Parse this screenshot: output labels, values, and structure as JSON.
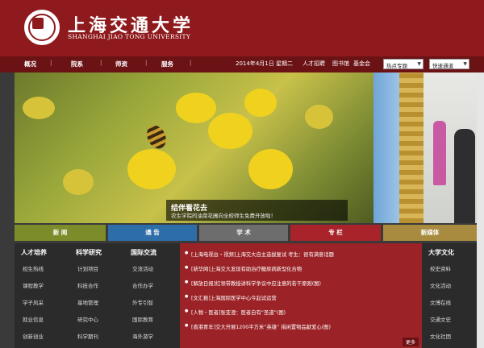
{
  "header": {
    "title_cn": "上海交通大学",
    "title_en": "SHANGHAI JIAO TONG UNIVERSITY"
  },
  "nav": {
    "items": [
      "概况",
      "院系",
      "师资",
      "服务"
    ],
    "separator": "|",
    "date": "2014年4月1日  星期二",
    "links": [
      "人才招聘",
      "图书馆",
      "基金会"
    ],
    "selects": [
      "热点专题",
      "快速通道"
    ]
  },
  "banner": {
    "caption_title": "结伴看花去",
    "caption_sub": "农生学院的油菜花圃向全校师生免费开放啦！"
  },
  "tabs": [
    {
      "label": "新 闻",
      "color": "#7d8c2a"
    },
    {
      "label": "通 告",
      "color": "#2e6ea8"
    },
    {
      "label": "学 术",
      "color": "#6d6d6d"
    },
    {
      "label": "专 栏",
      "color": "#a8242a"
    },
    {
      "label": "新媒体",
      "color": "#a88b3f"
    }
  ],
  "columns": [
    {
      "head": "人才培养",
      "items": [
        "招生热线",
        "课程教学",
        "学子风采",
        "就业信息",
        "创新创业"
      ]
    },
    {
      "head": "科学研究",
      "items": [
        "计划项目",
        "科技合作",
        "基地管理",
        "研究中心",
        "科学期刊"
      ]
    },
    {
      "head": "国际交流",
      "items": [
        "交流活动",
        "合作办学",
        "外专引智",
        "国际教育",
        "海外游学"
      ]
    }
  ],
  "news": [
    "[上海电视台・视频]上海交大自主选拔复试 考生：很有满意话题",
    "[新华网]上海交大发现有助治疗糖尿病新型化合物",
    "[解放日报]红领带教授讲科学争议中应注意的若干原则(图)",
    "[文汇报]上海国际医学中心今起试运营",
    "[人物・医者]张亚澄：医者自有“圣道”(图)",
    "[香港青年]交大开展1200平方米“英雄”  捐闲置物品献爱心(图)"
  ],
  "news_more": "更多",
  "right_column": {
    "head": "大学文化",
    "items": [
      "校史资料",
      "文化活动",
      "文博在线",
      "交通文史",
      "文化社团"
    ]
  }
}
